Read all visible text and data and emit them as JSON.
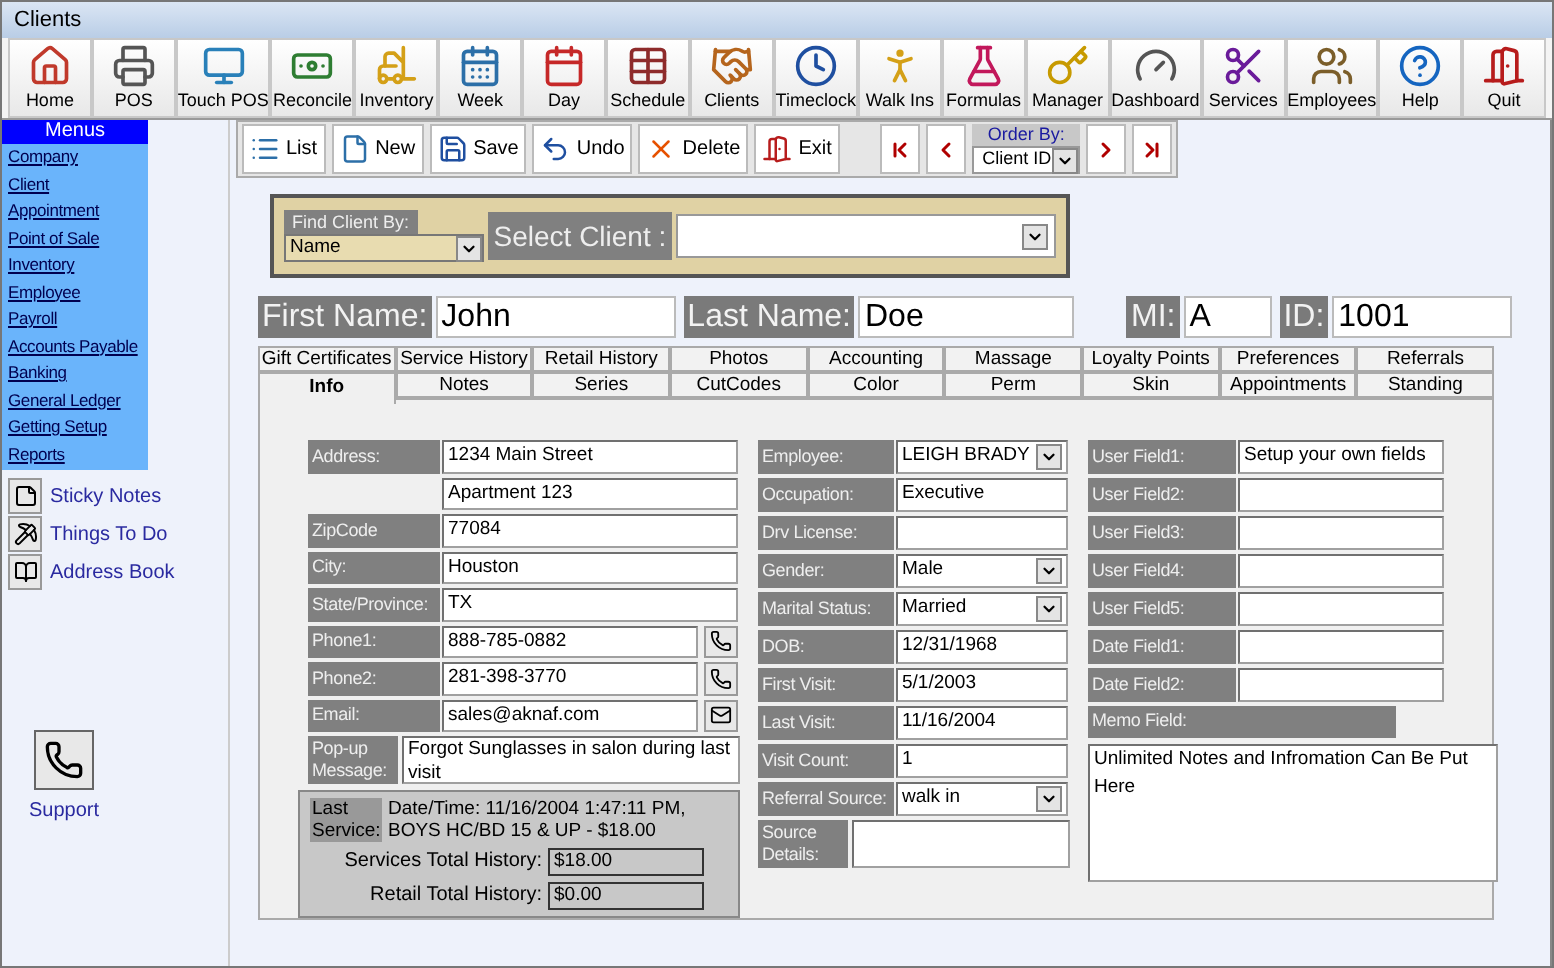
{
  "window": {
    "title": "Clients"
  },
  "toolbar": [
    {
      "label": "Home"
    },
    {
      "label": "POS"
    },
    {
      "label": "Touch POS"
    },
    {
      "label": "Reconcile"
    },
    {
      "label": "Inventory"
    },
    {
      "label": "Week"
    },
    {
      "label": "Day"
    },
    {
      "label": "Schedule"
    },
    {
      "label": "Clients"
    },
    {
      "label": "Timeclock"
    },
    {
      "label": "Walk Ins"
    },
    {
      "label": "Formulas"
    },
    {
      "label": "Manager"
    },
    {
      "label": "Dashboard"
    },
    {
      "label": "Services"
    },
    {
      "label": "Employees"
    },
    {
      "label": "Help"
    },
    {
      "label": "Quit"
    }
  ],
  "sidebar": {
    "header": "Menus",
    "items": [
      "Company",
      "Client",
      "Appointment",
      "Point of Sale",
      "Inventory",
      "Employee",
      "Payroll",
      "Accounts Payable",
      "Banking",
      "General Ledger",
      "Getting Setup",
      "Reports"
    ],
    "tools": [
      "Sticky Notes",
      "Things To Do",
      "Address Book"
    ],
    "support": "Support"
  },
  "record_toolbar": {
    "buttons": [
      "List",
      "New",
      "Save",
      "Undo",
      "Delete",
      "Exit"
    ],
    "order_by": {
      "label": "Order By:",
      "value": "Client ID"
    }
  },
  "find_client": {
    "label": "Find Client By:",
    "value": "Name",
    "select_label": "Select Client :"
  },
  "name_row": [
    {
      "label": "First Name:",
      "value": "John"
    },
    {
      "label": "Last Name:",
      "value": "Doe"
    },
    {
      "label": "MI:",
      "value": "A"
    },
    {
      "label": "ID:",
      "value": "1001"
    }
  ],
  "tabs": [
    [
      {
        "label": "Gift Certificates",
        "selected": false
      },
      {
        "label": "Service History",
        "selected": false
      },
      {
        "label": "Retail History",
        "selected": false
      },
      {
        "label": "Photos",
        "selected": false
      },
      {
        "label": "Accounting",
        "selected": false
      },
      {
        "label": "Massage",
        "selected": false
      },
      {
        "label": "Loyalty Points",
        "selected": false
      },
      {
        "label": "Preferences",
        "selected": false
      },
      {
        "label": "Referrals",
        "selected": false
      }
    ],
    [
      {
        "label": "Info",
        "selected": true
      },
      {
        "label": "Notes",
        "selected": false
      },
      {
        "label": "Series",
        "selected": false
      },
      {
        "label": "CutCodes",
        "selected": false
      },
      {
        "label": "Color",
        "selected": false
      },
      {
        "label": "Perm",
        "selected": false
      },
      {
        "label": "Skin",
        "selected": false
      },
      {
        "label": "Appointments",
        "selected": false
      },
      {
        "label": "Standing",
        "selected": false
      }
    ]
  ],
  "left_fields": [
    {
      "kind": "text",
      "label": "Address:",
      "value": "1234 Main Street"
    },
    {
      "kind": "text",
      "value": "Apartment 123"
    },
    {
      "kind": "text",
      "label": "ZipCode",
      "value": "77084"
    },
    {
      "kind": "text",
      "label": "City:",
      "value": "Houston"
    },
    {
      "kind": "text",
      "label": "State/Province:",
      "value": "TX"
    },
    {
      "kind": "phone",
      "label": "Phone1:",
      "value": "888-785-0882"
    },
    {
      "kind": "phone",
      "label": "Phone2:",
      "value": "281-398-3770"
    },
    {
      "kind": "email",
      "label": "Email:",
      "value": "sales@aknaf.com"
    },
    {
      "kind": "memo",
      "label": "Pop-up Message:",
      "value": "Forgot Sunglasses in salon during last visit"
    }
  ],
  "last_service": {
    "label": "Last Service:",
    "text": "Date/Time: 11/16/2004 1:47:11 PM, BOYS HC/BD 15 & UP - $18.00",
    "totals": [
      {
        "label": "Services Total History:",
        "value": "$18.00"
      },
      {
        "label": "Retail Total History:",
        "value": "$0.00"
      }
    ]
  },
  "middle_fields": [
    {
      "kind": "dropdown",
      "label": "Employee:",
      "value": "LEIGH BRADY"
    },
    {
      "kind": "text",
      "label": "Occupation:",
      "value": "Executive"
    },
    {
      "kind": "text",
      "label": "Drv License:"
    },
    {
      "kind": "dropdown",
      "label": "Gender:",
      "value": "Male"
    },
    {
      "kind": "dropdown",
      "label": "Marital Status:",
      "value": "Married"
    },
    {
      "kind": "text",
      "label": "DOB:",
      "value": "12/31/1968"
    },
    {
      "kind": "text",
      "label": "First Visit:",
      "value": "5/1/2003"
    },
    {
      "kind": "text",
      "label": "Last Visit:",
      "value": "11/16/2004"
    },
    {
      "kind": "text",
      "label": "Visit Count:",
      "value": "1"
    },
    {
      "kind": "dropdown",
      "label": "Referral Source:",
      "value": "walk in"
    },
    {
      "kind": "memo",
      "label": "Source Details:"
    }
  ],
  "right_fields": [
    {
      "label": "User Field1:",
      "value": "Setup your own fields"
    },
    {
      "label": "User Field2:"
    },
    {
      "label": "User Field3:"
    },
    {
      "label": "User Field4:"
    },
    {
      "label": "User Field5:"
    },
    {
      "label": "Date Field1:"
    },
    {
      "label": "Date Field2:"
    }
  ],
  "memo": {
    "label": "Memo Field:",
    "value": "Unlimited Notes and Infromation Can Be Put Here"
  }
}
